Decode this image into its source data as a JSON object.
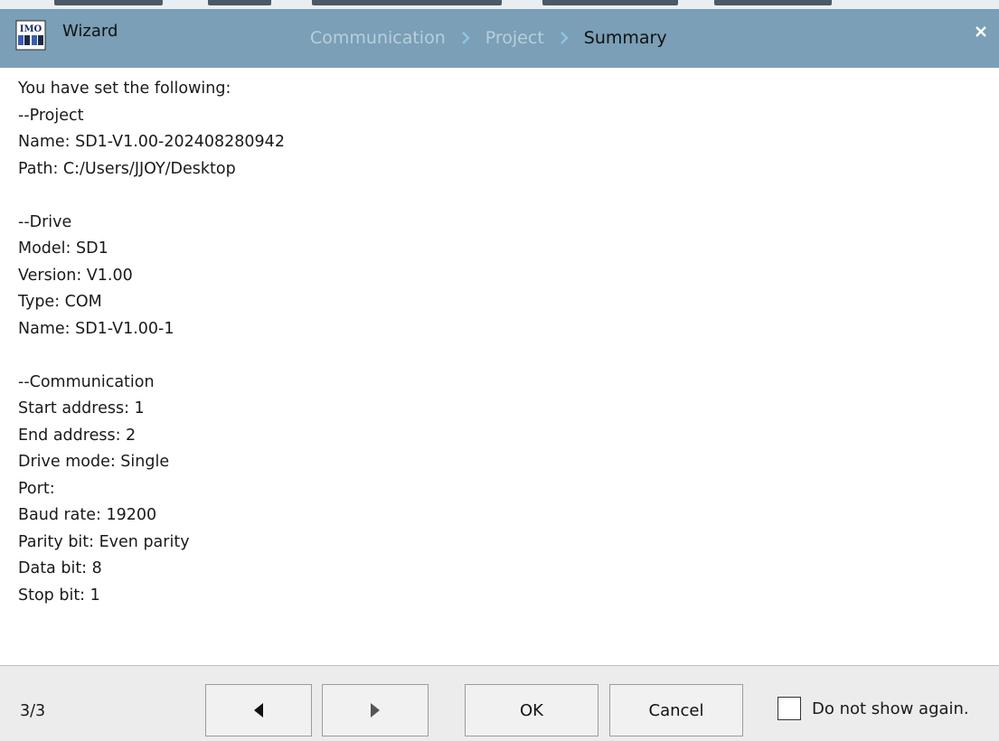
{
  "window": {
    "title": "Wizard",
    "app_icon": "imo-logo-icon",
    "app_icon_text": "IMO",
    "close_icon": "close-icon"
  },
  "steps": [
    {
      "label": "Communication",
      "state": "done"
    },
    {
      "label": "Project",
      "state": "done"
    },
    {
      "label": "Summary",
      "state": "active"
    }
  ],
  "summary": {
    "lines": [
      "You have set the following:",
      "--Project",
      "Name: SD1-V1.00-202408280942",
      "Path: C:/Users/JJOY/Desktop",
      "",
      "--Drive",
      "Model: SD1",
      "Version: V1.00",
      "Type: COM",
      "Name: SD1-V1.00-1",
      "",
      "--Communication",
      "Start address: 1",
      "End address: 2",
      "Drive mode: Single",
      "Port:",
      "Baud rate: 19200",
      "Parity bit: Even parity",
      "Data bit: 8",
      "Stop bit: 1"
    ]
  },
  "footer": {
    "page_indicator": "3/3",
    "prev_icon": "triangle-left-icon",
    "next_icon": "triangle-right-icon",
    "ok_label": "OK",
    "cancel_label": "Cancel",
    "dont_show_label": "Do not show again.",
    "dont_show_checked": false
  },
  "colors": {
    "titlebar": "#7a9fb6",
    "step_inactive": "#b8cfdd",
    "step_active": "#111111",
    "chevron": "#8fc4e8",
    "footer": "#ececec"
  }
}
